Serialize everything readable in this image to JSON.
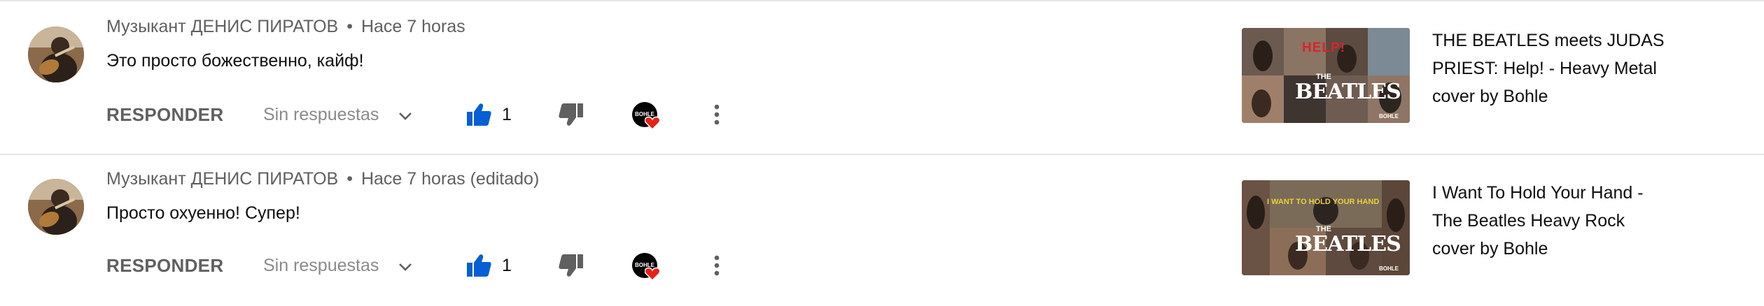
{
  "comments": [
    {
      "author": "Музыкант ДЕНИС ПИРАТОВ",
      "separator": "•",
      "time": "Hace 7 horas",
      "text": "Это просто божественно, кайф!",
      "reply_label": "RESPONDER",
      "replies_label": "Sin respuestas",
      "like_count": "1",
      "creator_badge_text": "BOHLE",
      "video": {
        "title_lines": [
          "THE BEATLES meets JUDAS",
          "PRIEST: Help! - Heavy Metal",
          "cover by Bohle"
        ],
        "thumb_top_text": "HELP!",
        "thumb_logo_small": "THE",
        "thumb_logo_big": "BEATLES",
        "thumb_corner_text": "BOHLE"
      }
    },
    {
      "author": "Музыкант ДЕНИС ПИРАТОВ",
      "separator": "•",
      "time": "Hace 7 horas (editado)",
      "text": "Просто охуенно! Супер!",
      "reply_label": "RESPONDER",
      "replies_label": "Sin respuestas",
      "like_count": "1",
      "creator_badge_text": "BOHLE",
      "video": {
        "title_lines": [
          "I Want To Hold Your Hand -",
          "The Beatles Heavy Rock",
          "cover by Bohle"
        ],
        "thumb_top_text": "I WANT TO HOLD YOUR HAND",
        "thumb_logo_small": "THE",
        "thumb_logo_big": "BEATLES",
        "thumb_corner_text": "BOHLE"
      }
    }
  ],
  "colors": {
    "like_blue": "#065fd4",
    "heart_red": "#e62117",
    "meta_gray": "#606060",
    "divider": "#e5e5e5"
  },
  "icons": [
    "thumbs-up-icon",
    "thumbs-down-icon",
    "chevron-down-icon",
    "more-vert-icon",
    "heart-icon"
  ]
}
